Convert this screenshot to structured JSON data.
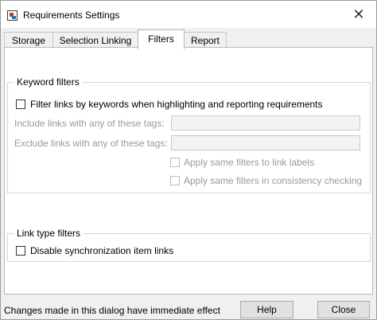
{
  "window": {
    "title": "Requirements Settings",
    "close_glyph": "✕"
  },
  "tabs": [
    {
      "label": "Storage"
    },
    {
      "label": "Selection Linking"
    },
    {
      "label": "Filters",
      "active": true
    },
    {
      "label": "Report"
    }
  ],
  "keyword_filters": {
    "legend": "Keyword filters",
    "filter_by_keywords": {
      "label": "Filter links by keywords when highlighting and reporting requirements",
      "checked": false
    },
    "include_label": "Include links with any of these tags:",
    "include_value": "",
    "exclude_label": "Exclude links with any of these tags:",
    "exclude_value": "",
    "apply_link_labels": {
      "label": "Apply same filters to link labels",
      "checked": false,
      "enabled": false
    },
    "apply_consistency": {
      "label": "Apply same filters in consistency checking",
      "checked": false,
      "enabled": false
    }
  },
  "link_type_filters": {
    "legend": "Link type filters",
    "disable_sync": {
      "label": "Disable synchronization item links",
      "checked": false
    }
  },
  "footer": {
    "status": "Changes made in this dialog have immediate effect",
    "help_label": "Help",
    "close_label": "Close"
  }
}
